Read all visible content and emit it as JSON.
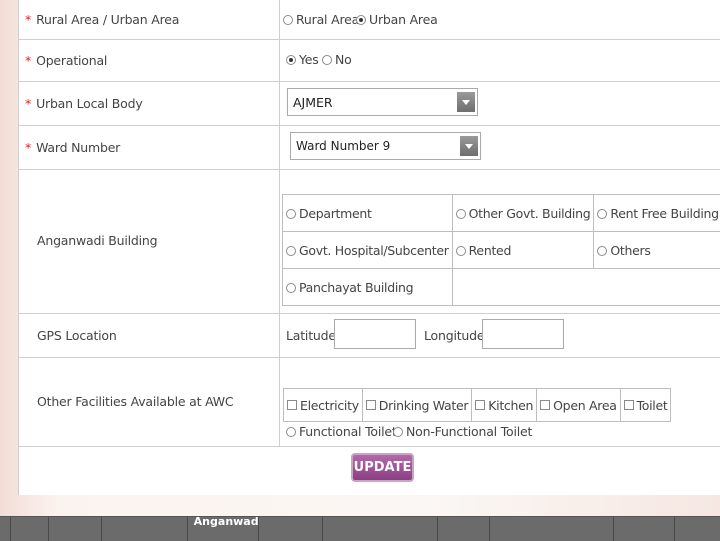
{
  "rows": {
    "area": {
      "label": "Rural Area / Urban Area",
      "options": [
        "Rural Area",
        "Urban Area"
      ],
      "selected": "Urban Area"
    },
    "operational": {
      "label": "Operational",
      "options": [
        "Yes",
        "No"
      ],
      "selected": "Yes"
    },
    "ulb": {
      "label": "Urban Local Body",
      "value": "AJMER"
    },
    "ward": {
      "label": "Ward Number",
      "value": "Ward Number 9"
    },
    "building": {
      "label": "Anganwadi Building",
      "options": [
        "Department",
        "Other Govt. Building",
        "Rent Free Building",
        "Govt. Hospital/Subcenter",
        "Rented",
        "Others",
        "Panchayat Building"
      ]
    },
    "gps": {
      "label": "GPS Location",
      "latitude_label": "Latitude",
      "longitude_label": "Longitude"
    },
    "facilities": {
      "label": "Other Facilities Available at AWC",
      "checkboxes": [
        "Electricity",
        "Drinking Water",
        "Kitchen",
        "Open Area",
        "Toilet"
      ],
      "radios": [
        "Functional Toilet",
        "Non-Functional Toilet"
      ]
    }
  },
  "update_label": "UPDATE",
  "table_header_visible": "Anganwadi"
}
